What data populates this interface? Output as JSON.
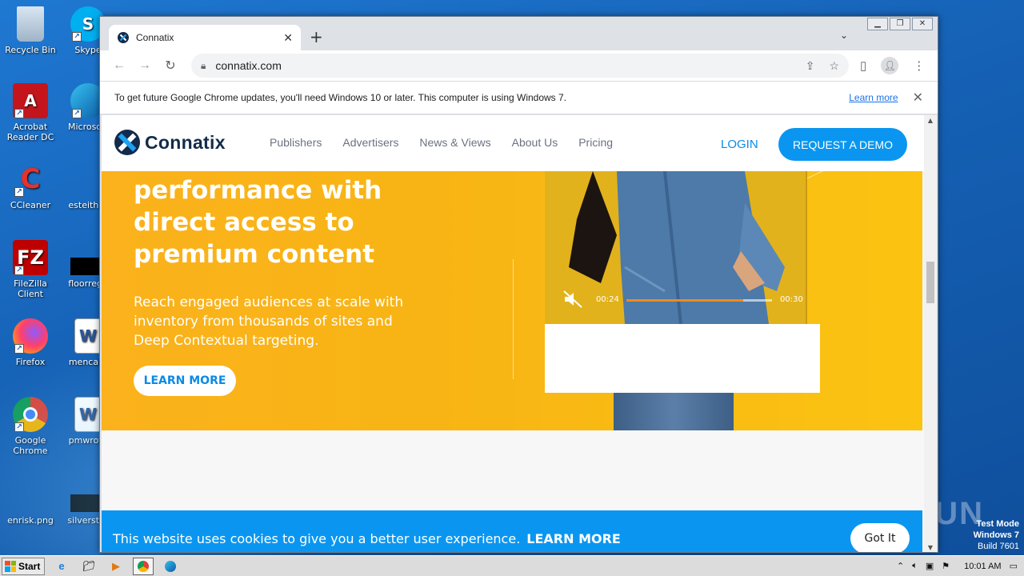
{
  "desktop": {
    "icons": [
      {
        "label": "Recycle Bin"
      },
      {
        "label": "Skype"
      },
      {
        "label": "Acrobat Reader DC"
      },
      {
        "label": "Microsoft"
      },
      {
        "label": "CCleaner"
      },
      {
        "label": "esteither"
      },
      {
        "label": "FileZilla Client"
      },
      {
        "label": "floorrega"
      },
      {
        "label": "Firefox"
      },
      {
        "label": "mencare"
      },
      {
        "label": "Google Chrome"
      },
      {
        "label": "pmwrote"
      },
      {
        "label": "enrisk.png"
      },
      {
        "label": "silverstru"
      }
    ],
    "watermark": "ANY RUN",
    "test_mode": {
      "line1": "Test Mode",
      "line2": "Windows 7",
      "line3": "Build 7601"
    }
  },
  "browser": {
    "tab_title": "Connatix",
    "url": "connatix.com",
    "infobar_text": "To get future Google Chrome updates, you'll need Windows 10 or later. This computer is using Windows 7.",
    "infobar_link": "Learn more"
  },
  "site": {
    "logo_text": "Connatix",
    "nav": [
      "Publishers",
      "Advertisers",
      "News & Views",
      "About Us",
      "Pricing"
    ],
    "login": "LOGIN",
    "demo_button": "REQUEST A DEMO",
    "hero_title": "performance with direct access to premium content",
    "hero_subtitle": "Reach engaged audiences at scale with inventory from thousands of sites and Deep Contextual targeting.",
    "hero_button": "LEARN MORE",
    "video": {
      "current_time": "00:24",
      "duration": "00:30",
      "progress": 0.8
    },
    "cookie_text": "This website uses cookies to give you a better user experience.",
    "cookie_link": "LEARN MORE",
    "cookie_button": "Got It"
  },
  "taskbar": {
    "start_label": "Start",
    "clock": "10:01 AM"
  },
  "colors": {
    "accent": "#0a96f0",
    "hero": "#f8b414",
    "navy": "#132b4a"
  }
}
